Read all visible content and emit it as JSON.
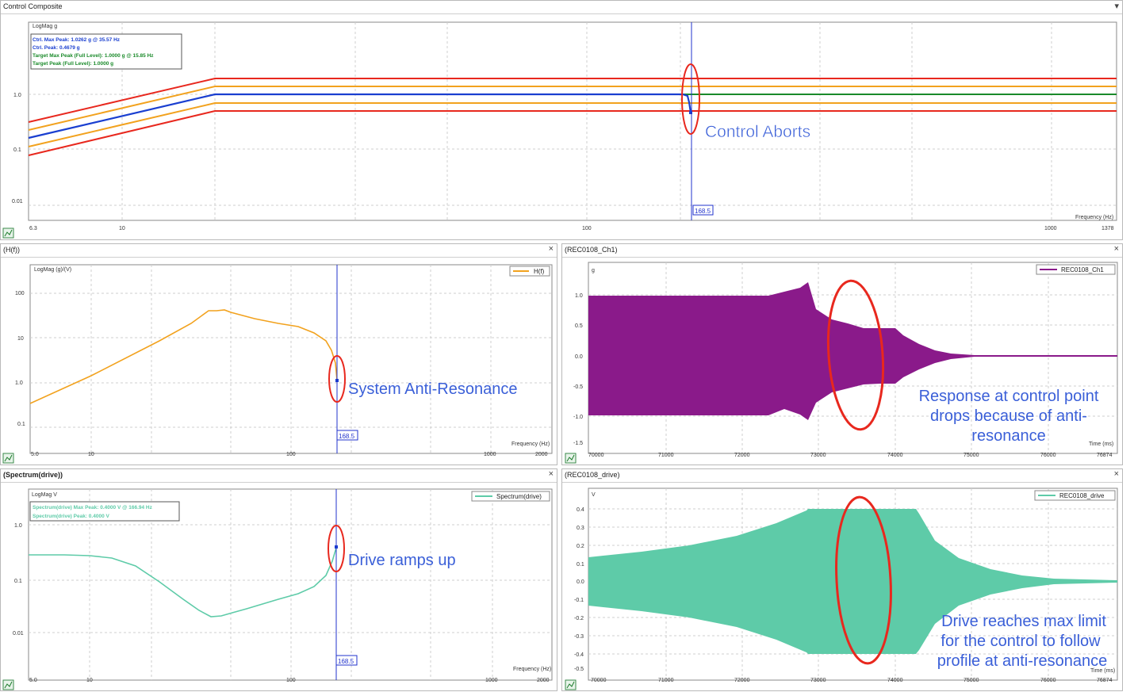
{
  "colors": {
    "grid": "#c8c8c8",
    "cursor": "#2233cc",
    "red": "#e8281e",
    "orange": "#f2a21e",
    "green": "#1a8a2a",
    "blue": "#1a3fd0",
    "hf": "#f2a21e",
    "purple": "#8a1a8a",
    "teal": "#5ecba8",
    "annot": "#3a5fd8",
    "ellipse": "#e8281e"
  },
  "panels": {
    "composite": {
      "title": "Control Composite",
      "ylabel": "LogMag g",
      "xlabel": "Frequency (Hz)",
      "xticks": [
        "6.3",
        "10",
        "100",
        "1000",
        "1378"
      ],
      "yticks": [
        "1.0",
        "0.1",
        "0.01"
      ],
      "cursor": "168.5",
      "legend": [
        "Ctrl. Max Peak: 1.0262 g @ 35.57 Hz",
        "Ctrl. Peak: 0.4679 g",
        "Target Max Peak (Full Level): 1.0000 g @ 15.85 Hz",
        "Target Peak (Full Level): 1.0000 g"
      ],
      "annotation": "Control Aborts"
    },
    "hf": {
      "title": "(H(f))",
      "ylabel": "LogMag (g)/(V)",
      "xlabel": "Frequency (Hz)",
      "xticks": [
        "5.0",
        "10",
        "100",
        "1000",
        "2000"
      ],
      "yticks": [
        "100",
        "10",
        "1.0",
        "0.1"
      ],
      "legend": "H(f)",
      "cursor": "168.5",
      "annotation": "System Anti-Resonance"
    },
    "rec_ch1": {
      "title": "(REC0108_Ch1)",
      "ylabel": "g",
      "xlabel": "Time (ms)",
      "xticks": [
        "70000",
        "71000",
        "72000",
        "73000",
        "74000",
        "75000",
        "76000",
        "76874"
      ],
      "yticks": [
        "1.0",
        "0.5",
        "0.0",
        "-0.5",
        "-1.0",
        "-1.5"
      ],
      "legend": "REC0108_Ch1",
      "annotation": [
        "Response at control point",
        "drops because of anti-",
        "resonance"
      ]
    },
    "spectrum": {
      "title": "(Spectrum(drive))",
      "ylabel": "LogMag V",
      "xlabel": "Frequency (Hz)",
      "xticks": [
        "5.0",
        "10",
        "100",
        "1000",
        "2000"
      ],
      "yticks": [
        "1.0",
        "0.1",
        "0.01"
      ],
      "legend": "Spectrum(drive)",
      "info": [
        "Spectrum(drive) Max Peak: 0.4000 V @ 166.94 Hz",
        "Spectrum(drive) Peak: 0.4000 V"
      ],
      "cursor": "168.5",
      "annotation": "Drive ramps up"
    },
    "rec_drive": {
      "title": "(REC0108_drive)",
      "ylabel": "V",
      "xlabel": "Time (ms)",
      "xticks": [
        "70000",
        "71000",
        "72000",
        "73000",
        "74000",
        "75000",
        "76000",
        "76874"
      ],
      "yticks": [
        "0.4",
        "0.3",
        "0.2",
        "0.1",
        "0.0",
        "-0.1",
        "-0.2",
        "-0.3",
        "-0.4",
        "-0.5"
      ],
      "legend": "REC0108_drive",
      "annotation": [
        "Drive reaches max limit",
        "for the control to follow",
        "profile at anti-resonance"
      ]
    }
  }
}
